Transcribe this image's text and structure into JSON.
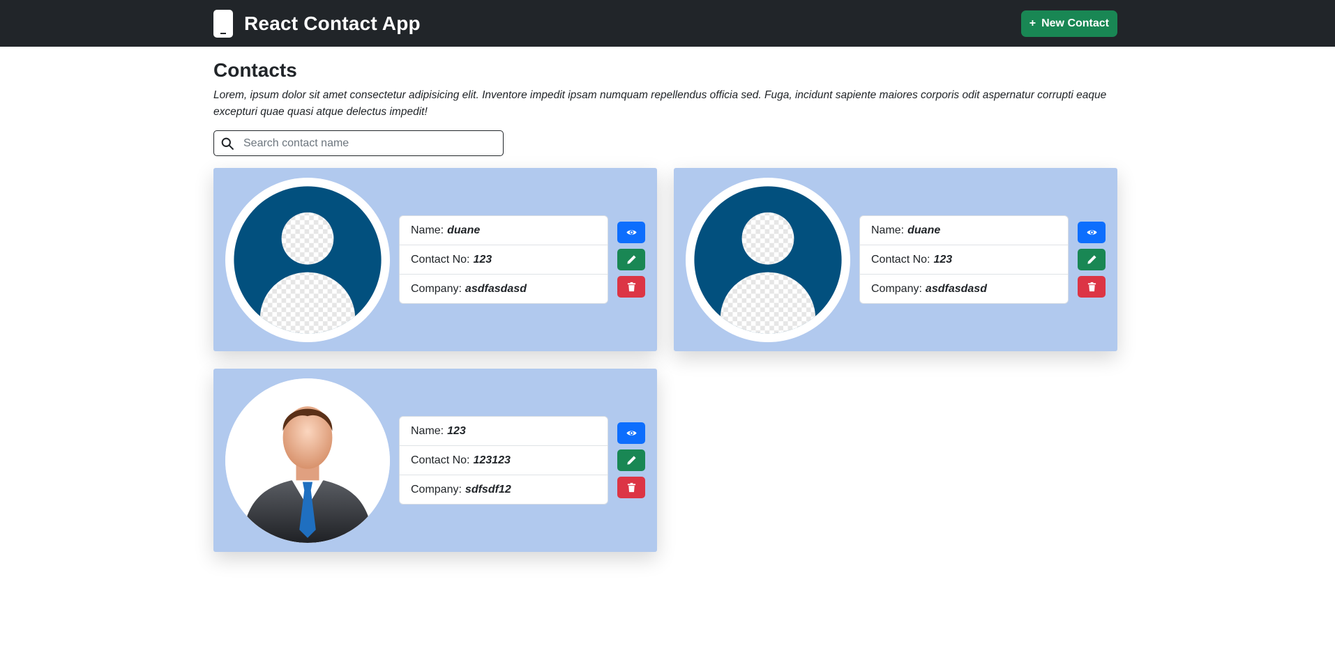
{
  "navbar": {
    "title": "React Contact App",
    "new_contact_label": "New Contact"
  },
  "main": {
    "heading": "Contacts",
    "intro": "Lorem, ipsum dolor sit amet consectetur adipisicing elit. Inventore impedit ipsam numquam repellendus officia sed. Fuga, incidunt sapiente maiores corporis odit aspernatur corrupti eaque excepturi quae quasi atque delectus impedit!",
    "search_placeholder": "Search contact name"
  },
  "labels": {
    "name": "Name:",
    "contact_no": "Contact No:",
    "company": "Company:"
  },
  "contacts": [
    {
      "avatar": "default-user-icon",
      "name": "duane",
      "contact_no": "123",
      "company": "asdfasdasd"
    },
    {
      "avatar": "default-user-icon",
      "name": "duane",
      "contact_no": "123",
      "company": "asdfasdasd"
    },
    {
      "avatar": "businessman-photo",
      "name": "123",
      "contact_no": "123123",
      "company": "sdfsdf12"
    }
  ],
  "colors": {
    "navbar_bg": "#212529",
    "success": "#198754",
    "primary": "#0d6efd",
    "danger": "#dc3545",
    "card_bg": "#b1c9ee",
    "avatar_blue": "#02507e"
  }
}
